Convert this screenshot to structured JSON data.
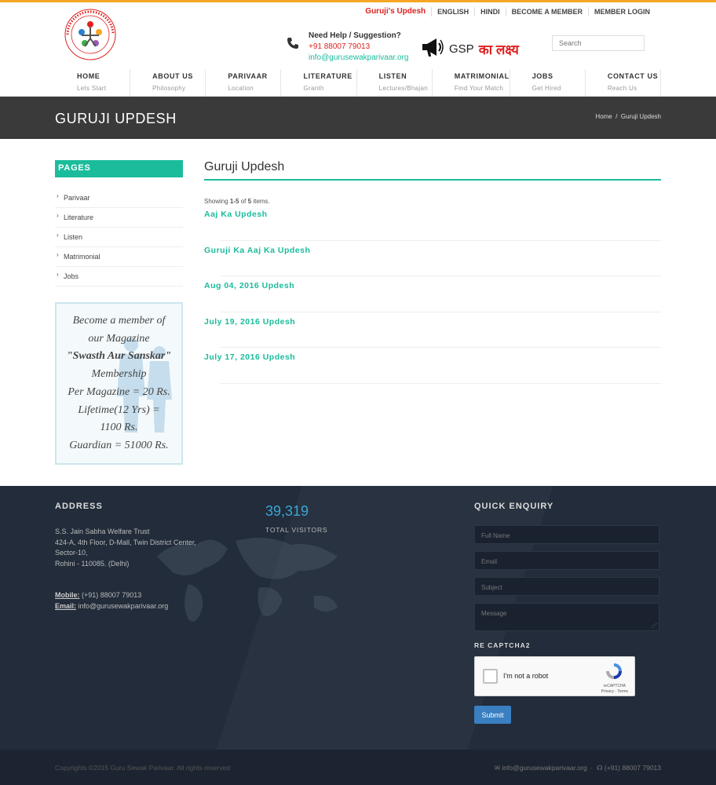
{
  "header": {
    "top_links": [
      "Guruji's Updesh",
      "ENGLISH",
      "HINDI",
      "BECOME A MEMBER",
      "MEMBER LOGIN"
    ],
    "help_title": "Need Help / Suggestion?",
    "help_phone": "+91 88007 79013",
    "help_email": "info@gurusewakparivaar.org",
    "gsp_label": "GSP",
    "gsp_hindi": "का लक्ष्य",
    "logo_ring_text": "GURU SEWAK PARIVAAR · SOCIAL HELPING HAND",
    "search_placeholder": "Search"
  },
  "nav": [
    {
      "label": "HOME",
      "sub": "Lets Start"
    },
    {
      "label": "ABOUT US",
      "sub": "Philosophy"
    },
    {
      "label": "PARIVAAR",
      "sub": "Location"
    },
    {
      "label": "LITERATURE",
      "sub": "Granth"
    },
    {
      "label": "LISTEN",
      "sub": "Lectures/Bhajan"
    },
    {
      "label": "MATRIMONIAL",
      "sub": "Find Your Match"
    },
    {
      "label": "JOBS",
      "sub": "Get Hired"
    },
    {
      "label": "CONTACT US",
      "sub": "Reach Us"
    }
  ],
  "banner": {
    "title": "GURUJI UPDESH",
    "crumb_home": "Home",
    "crumb_sep": "/",
    "crumb_current": "Guruji Updesh"
  },
  "sidebar": {
    "heading": "PAGES",
    "items": [
      "Parivaar",
      "Literature",
      "Listen",
      "Matrimonial",
      "Jobs"
    ],
    "membership": [
      "Become a member of",
      "our Magazine",
      "\"Swasth Aur Sanskar\"",
      "Membership",
      "Per Magazine = 20 Rs.",
      "Lifetime(12 Yrs) =",
      "1100 Rs.",
      "Guardian = 51000 Rs."
    ]
  },
  "main": {
    "title": "Guruji Updesh",
    "showing_pre": "Showing",
    "showing_range": "1-5",
    "showing_of": "of",
    "showing_total": "5",
    "showing_post": "items.",
    "items": [
      "Aaj Ka Updesh",
      "Guruji Ka Aaj Ka Updesh",
      "Aug 04, 2016 Updesh",
      "July 19, 2016 Updesh",
      "July 17, 2016 Updesh"
    ]
  },
  "footer": {
    "address_title": "ADDRESS",
    "address_lines": [
      "S.S. Jain Sabha Welfare Trust",
      "424-A, 4th Floor, D-Mall, Twin District Center,",
      "Sector-10,",
      "Rohini - 110085. (Delhi)"
    ],
    "mobile_label": "Mobile:",
    "mobile_value": " (+91) 88007 79013",
    "email_label": "Email:",
    "email_value": " info@gurusewakparivaar.org",
    "visitors_count": "39,319",
    "visitors_label": "TOTAL VISITORS",
    "enquiry_title": "QUICK ENQUIRY",
    "fields": {
      "name": "Full Name",
      "email": "Email",
      "subject": "Subject",
      "message": "Message"
    },
    "recaptcha_title": "RE CAPTCHA2",
    "recaptcha_label": "I'm not a robot",
    "recaptcha_brand": "reCAPTCHA",
    "recaptcha_links": "Privacy - Terms",
    "submit_label": "Submit"
  },
  "bottom": {
    "copyright": "Copyrights ©2015 Guru Sewak Parivaar. All rights reserved",
    "email": "info@gurusewakparivaar.org",
    "phone": "(+91) 88007 79013"
  },
  "colors": {
    "accent": "#1abc9c",
    "red": "#e02020",
    "orange": "#f5a623",
    "footer": "#222c3a",
    "button": "#3a7fc1"
  }
}
